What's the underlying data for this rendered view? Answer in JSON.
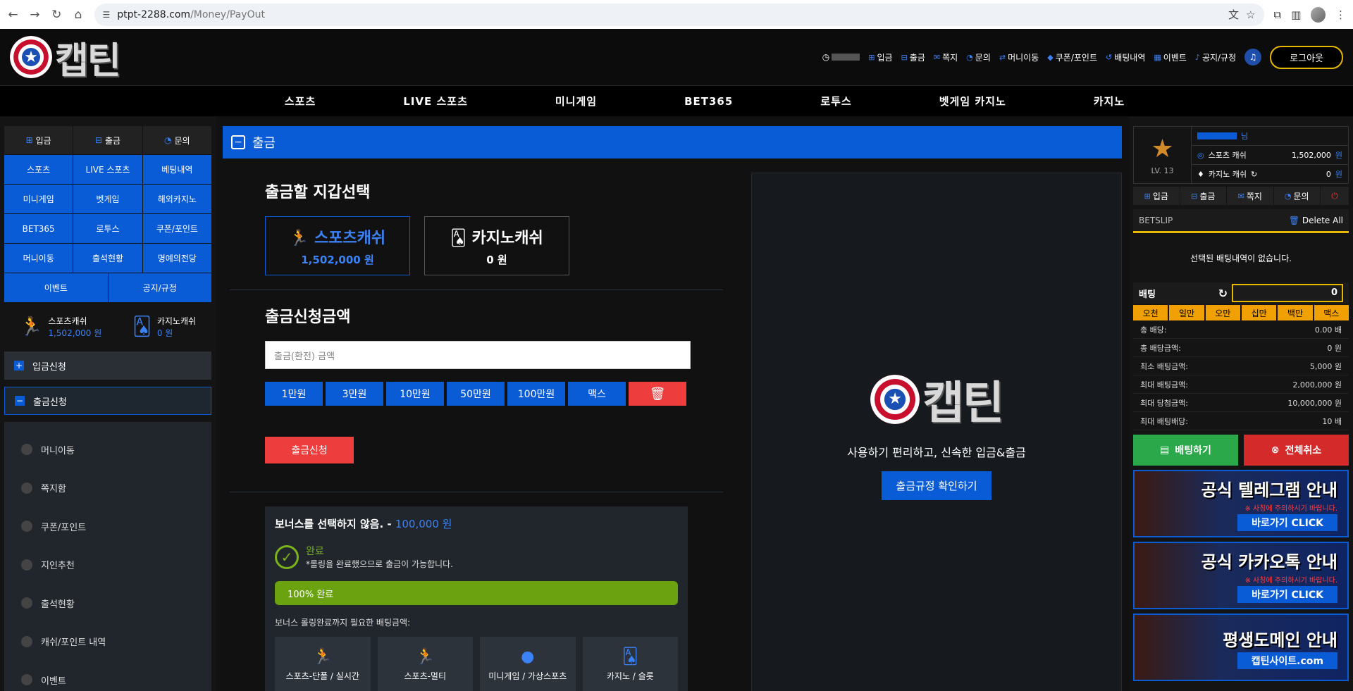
{
  "browser": {
    "url_domain": "ptpt-2288.com",
    "url_path": "/Money/PayOut"
  },
  "header": {
    "logo_text": "캡틴",
    "nav": [
      {
        "icon": "plus-icon",
        "label": "입금"
      },
      {
        "icon": "minus-icon",
        "label": "출금"
      },
      {
        "icon": "mail-icon",
        "label": "쪽지"
      },
      {
        "icon": "chat-icon",
        "label": "문의"
      },
      {
        "icon": "transfer-icon",
        "label": "머니이동"
      },
      {
        "icon": "coupon-icon",
        "label": "쿠폰/포인트"
      },
      {
        "icon": "history-icon",
        "label": "배팅내역"
      },
      {
        "icon": "calendar-icon",
        "label": "이벤트"
      },
      {
        "icon": "bell-icon",
        "label": "공지/규정"
      }
    ],
    "logout": "로그아웃"
  },
  "mainnav": [
    "스포츠",
    "LIVE 스포츠",
    "미니게임",
    "BET365",
    "로투스",
    "벳게임 카지노",
    "카지노"
  ],
  "left": {
    "top_buttons": [
      "입금",
      "출금",
      "문의"
    ],
    "grid": [
      "스포츠",
      "LIVE 스포츠",
      "베팅내역",
      "미니게임",
      "벳게임",
      "해외카지노",
      "BET365",
      "로투스",
      "쿠폰/포인트",
      "머니이동",
      "출석현황",
      "명예의전당"
    ],
    "grid2": [
      "이벤트",
      "공지/규정"
    ],
    "sports_cash_label": "스포츠캐쉬",
    "sports_cash_value": "1,502,000 원",
    "casino_cash_label": "카지노캐쉬",
    "casino_cash_value": "0 원",
    "deposit_request": "입금신청",
    "withdraw_request": "출금신청",
    "sub_items": [
      "머니이동",
      "쪽지함",
      "쿠폰/포인트",
      "지인추천",
      "출석현황",
      "캐쉬/포인트 내역",
      "이벤트"
    ]
  },
  "main": {
    "panel_title": "출금",
    "wallet_select_title": "출금할 지갑선택",
    "wallets": [
      {
        "name": "스포츠캐쉬",
        "value": "1,502,000 원"
      },
      {
        "name": "카지노캐쉬",
        "value": "0 원"
      }
    ],
    "amount_title": "출금신청금액",
    "amount_placeholder": "출금(환전) 금액",
    "quick_amounts": [
      "1만원",
      "3만원",
      "10만원",
      "50만원",
      "100만원",
      "맥스"
    ],
    "apply_button": "출금신청",
    "bonus_title": "보너스를 선택하지 않음. -",
    "bonus_amount": "100,000 원",
    "done_title": "완료",
    "done_desc": "*롤링을 완료했으므로 출금이 가능합니다.",
    "progress_label": "100% 완료",
    "progress_value": 1.0,
    "rolling_needed_label": "보너스 롤링완료까지 필요한 배팅금액:",
    "game_types": [
      "스포츠-단폴 / 실시간",
      "스포츠-멀티",
      "미니게임 / 가상스포츠",
      "카지노 / 슬롯"
    ],
    "info_slogan": "사용하기 편리하고, 신속한 입금&출금",
    "rule_button": "출금규정 확인하기"
  },
  "right": {
    "level": "LV. 13",
    "user_suffix": "님",
    "sports_cash_label": "스포츠 캐쉬",
    "sports_cash_value": "1,502,000",
    "casino_cash_label": "카지노 캐쉬",
    "casino_cash_value": "0",
    "unit": "원",
    "buttons": [
      "입금",
      "출금",
      "쪽지",
      "문의"
    ],
    "betslip_title": "BETSLIP",
    "delete_all": "Delete All",
    "empty_msg": "선택된 배팅내역이 없습니다.",
    "bet_label": "배팅",
    "bet_value": "0",
    "chips": [
      "오천",
      "일만",
      "오만",
      "십만",
      "백만",
      "맥스"
    ],
    "stats": [
      {
        "label": "총 배당:",
        "value": "0.00 배"
      },
      {
        "label": "총 배당금액:",
        "value": "0 원"
      },
      {
        "label": "최소 배팅금액:",
        "value": "5,000 원"
      },
      {
        "label": "최대 배팅금액:",
        "value": "2,000,000 원"
      },
      {
        "label": "최대 당첨금액:",
        "value": "10,000,000 원"
      },
      {
        "label": "최대 배팅배당:",
        "value": "10 배"
      }
    ],
    "bet_button": "배팅하기",
    "cancel_button": "전체취소",
    "banners": [
      {
        "title": "공식 텔레그램 안내",
        "sub": "※ 사칭에 주의하시기 바랍니다.",
        "go": "바로가기 CLICK"
      },
      {
        "title": "공식 카카오톡 안내",
        "sub": "※ 사칭에 주의하시기 바랍니다.",
        "go": "바로가기 CLICK"
      },
      {
        "title": "평생도메인 안내",
        "sub": "",
        "go": "캡틴사이트.com"
      }
    ]
  },
  "colors": {
    "accent": "#0a5bd6",
    "danger": "#ee3d3d",
    "gold": "#e6b800",
    "success": "#6aa30f"
  }
}
